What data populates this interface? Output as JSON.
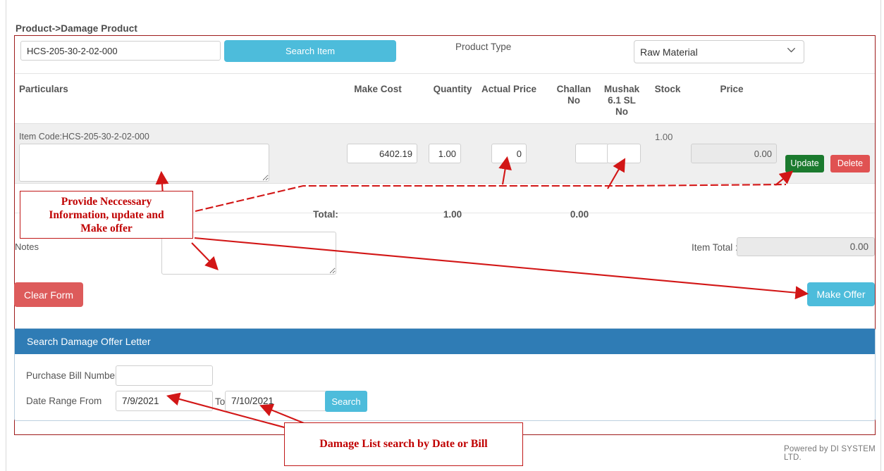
{
  "breadcrumb": "Product->Damage Product",
  "search_bar": {
    "item_code_value": "HCS-205-30-2-02-000",
    "item_code_placeholder": "",
    "search_item_label": "Search Item",
    "product_type_label": "Product Type",
    "product_type_selected": "Raw Material",
    "product_type_options": [
      "Raw Material"
    ]
  },
  "table": {
    "headers": [
      "Particulars",
      "Make Cost",
      "Quantity",
      "Actual Price",
      "Challan No",
      "Mushak 6.1 SL No",
      "Stock",
      "Price"
    ],
    "header_challan_line1": "Challan",
    "header_challan_line2": "No",
    "header_mushak_line1": "Mushak",
    "header_mushak_line2": "6.1 SL",
    "header_mushak_line3": "No",
    "row": {
      "item_code_text": "Item Code:HCS-205-30-2-02-000",
      "particulars_value": "",
      "make_cost": "6402.19",
      "quantity": "1.00",
      "actual_price": "0",
      "challan_no": "",
      "mushak_no": "",
      "stock": "1.00",
      "price": "0.00",
      "update_label": "Update",
      "delete_label": "Delete"
    },
    "totals": {
      "label": "Total:",
      "quantity": "1.00",
      "actual_price": "0.00"
    }
  },
  "form_footer": {
    "notes_label": "Notes",
    "notes_value": "",
    "item_total_label": "Item Total :",
    "item_total_value": "0.00",
    "clear_form_label": "Clear Form",
    "make_offer_label": "Make Offer"
  },
  "search_panel": {
    "title": "Search Damage Offer Letter",
    "bill_label": "Purchase Bill Number",
    "bill_value": "",
    "date_from_label": "Date Range From",
    "date_from_value": "7/9/2021",
    "to_label": "To",
    "date_to_value": "7/10/2021",
    "search_label": "Search"
  },
  "footer": {
    "powered_by": "Powered by DI SYSTEM LTD."
  },
  "annotations": {
    "note1_line1": "Provide Neccessary",
    "note1_line2": "Information, update and",
    "note1_line3": "Make offer",
    "note2": "Damage List search by Date or Bill"
  },
  "colors": {
    "accent_blue": "#4dbcdb",
    "panel_header_blue": "#2f7cb5",
    "update_green": "#1b7a2e",
    "delete_red": "#e05252",
    "clear_red": "#dd5b5b",
    "annotation_red": "#c00000",
    "frame_red": "#9e1b1b"
  }
}
